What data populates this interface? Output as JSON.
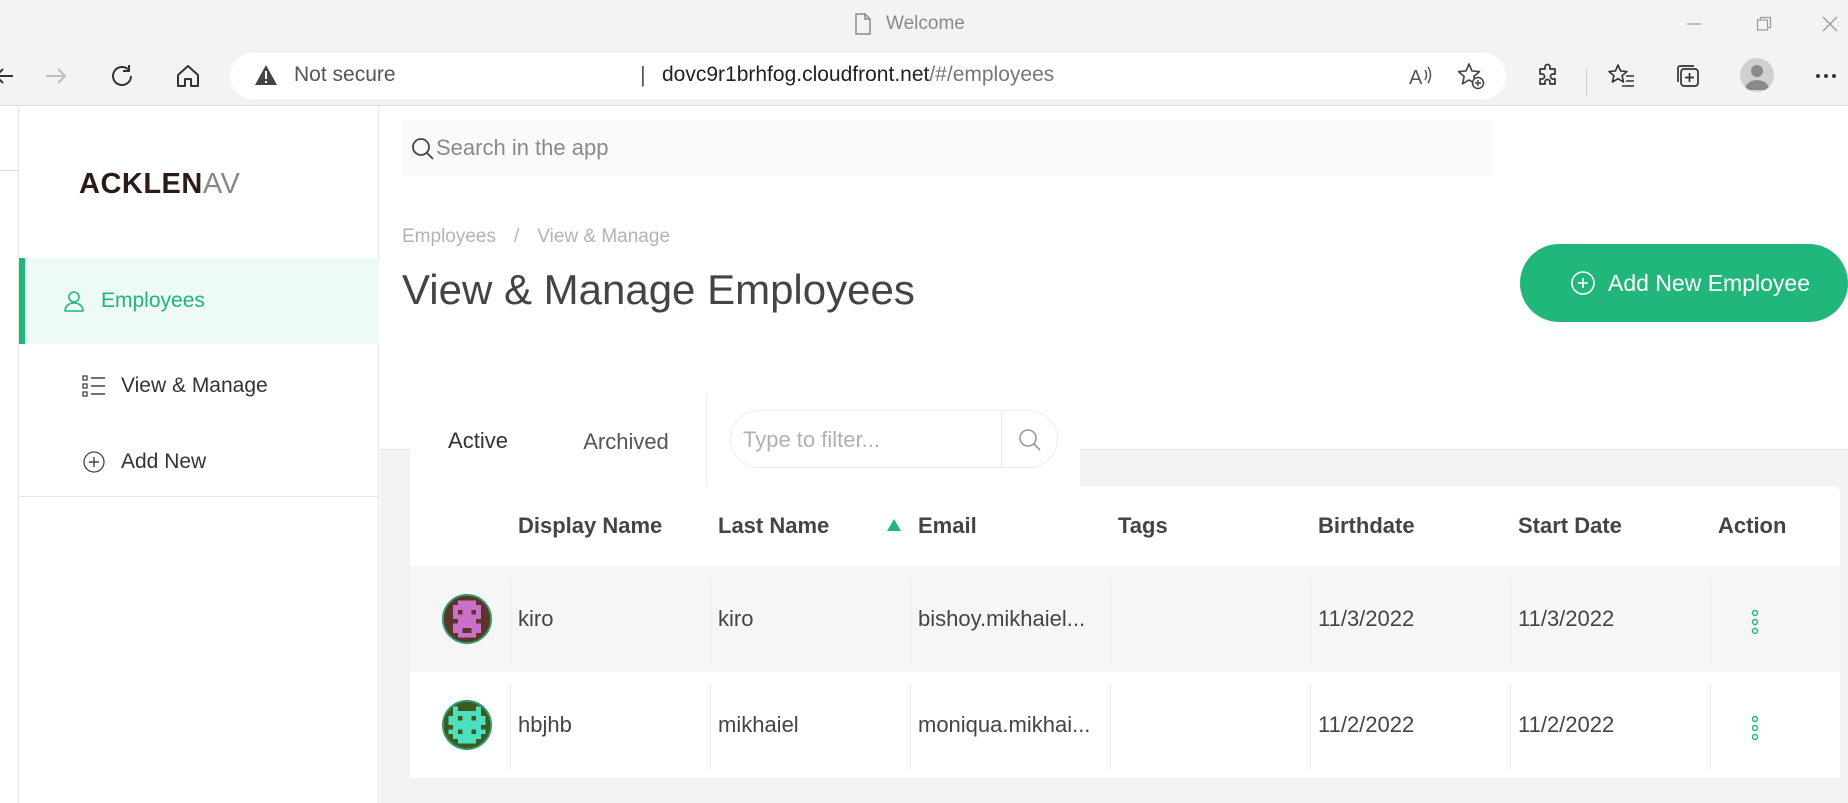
{
  "browser": {
    "window_title": "Welcome",
    "not_secure_label": "Not secure",
    "url_host": "dovc9r1brhfog.cloudfront.net",
    "url_path": "/#/employees"
  },
  "app": {
    "logo_bold": "ACKLEN",
    "logo_light": "AV",
    "search_placeholder": "Search in the app",
    "nav": {
      "employees": "Employees",
      "view_manage": "View & Manage",
      "add_new": "Add New"
    },
    "breadcrumb": [
      "Employees",
      "/",
      "View & Manage"
    ],
    "page_title": "View & Manage Employees",
    "add_button_label": "Add New Employee",
    "tabs": [
      "Active",
      "Archived"
    ],
    "filter_placeholder": "Type to filter...",
    "columns": [
      "Display Name",
      "Last Name",
      "Email",
      "Tags",
      "Birthdate",
      "Start Date",
      "Action"
    ],
    "rows": [
      {
        "display_name": "kiro",
        "last_name": "kiro",
        "email": "bishoy.mikhaiel...",
        "tags": "",
        "birthdate": "11/3/2022",
        "start_date": "11/3/2022"
      },
      {
        "display_name": "hbjhb",
        "last_name": "mikhaiel",
        "email": "moniqua.mikhai...",
        "tags": "",
        "birthdate": "11/2/2022",
        "start_date": "11/2/2022"
      }
    ]
  },
  "colors": {
    "accent": "#22b77a",
    "sidebar_active_bg": "#eefaf5"
  }
}
